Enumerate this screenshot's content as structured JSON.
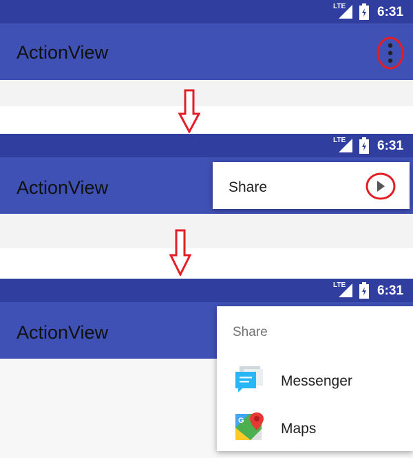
{
  "app_title": "ActionView",
  "status_time": "6:31",
  "status_network": "LTE",
  "colors": {
    "primary": "#3f51b5",
    "primary_dark": "#303f9f",
    "highlight": "#e31e24",
    "arrow": "#e31e24"
  },
  "panel1": {
    "overflow_icon": "more-vert-icon"
  },
  "panel2": {
    "menu_item_label": "Share",
    "submenu_icon": "arrow-right-icon"
  },
  "panel3": {
    "share_header": "Share",
    "share_items": [
      {
        "label": "Messenger",
        "icon": "messenger-icon"
      },
      {
        "label": "Maps",
        "icon": "maps-icon"
      }
    ]
  }
}
